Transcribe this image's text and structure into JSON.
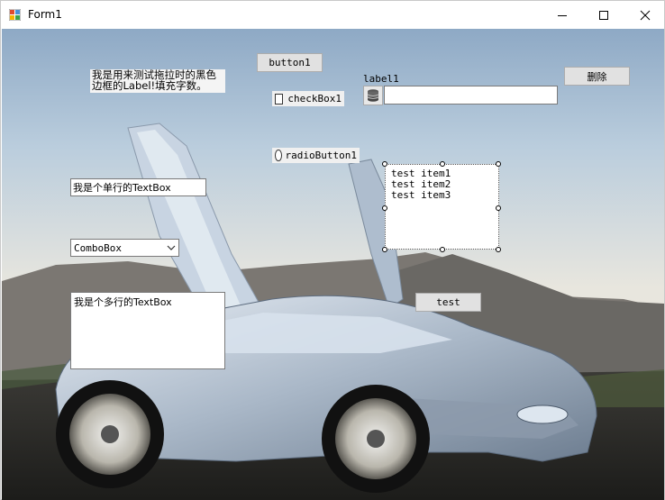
{
  "window": {
    "title": "Form1"
  },
  "form": {
    "label_black_border": "我是用来测试拖拉时的黑色边框的Label!填充字数。",
    "button1": "button1",
    "label1": "label1",
    "delete_button": "删除",
    "checkbox1": "checkBox1",
    "radiobutton1": "radioButton1",
    "single_line_textbox": "我是个单行的TextBox",
    "combobox_value": "ComboBox",
    "multi_line_textbox": "我是个多行的TextBox",
    "listbox_items": [
      "test item1",
      "test item2",
      "test item3"
    ],
    "test_button": "test"
  }
}
